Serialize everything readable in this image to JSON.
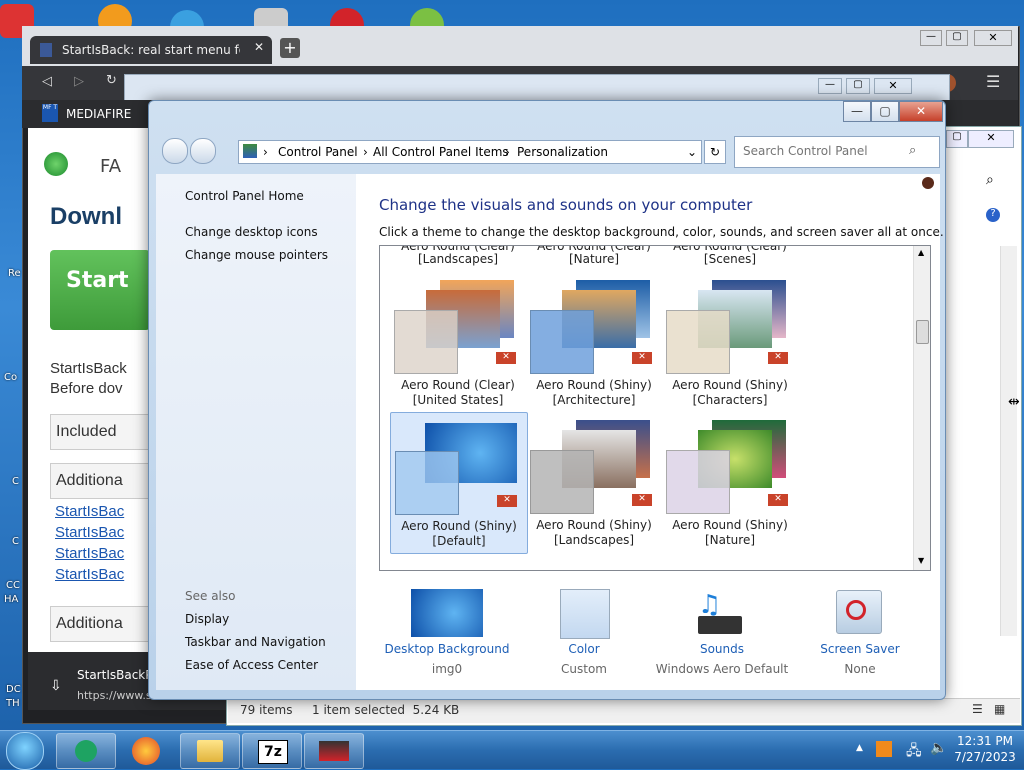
{
  "browser": {
    "tab_title": "StartIsBack: real start menu for Wi",
    "bookmark": "MEDIAFIRE",
    "bookmark_icon_text": "MF T",
    "page_letters": "FA",
    "page_title": "Downl",
    "green_button": "Start",
    "para1": "StartIsBack",
    "para2": "Before dov",
    "box1": "Included",
    "box2": "Additiona",
    "links": [
      "StartIsBac",
      "StartIsBac",
      "StartIsBac",
      "StartIsBac"
    ],
    "box3": "Additiona",
    "download_name": "StartIsBackPlu",
    "download_url": "https://www.st"
  },
  "desktop": {
    "labels": [
      "Re",
      "Co",
      "C",
      "C",
      "CC",
      "HA",
      "DC",
      "TH"
    ]
  },
  "window": {
    "address": [
      "Control Panel",
      "All Control Panel Items",
      "Personalization"
    ],
    "search_placeholder": "Search Control Panel"
  },
  "sidebar": {
    "home": "Control Panel Home",
    "links": [
      "Change desktop icons",
      "Change mouse pointers"
    ],
    "see_also": "See also",
    "see_also_links": [
      "Display",
      "Taskbar and Navigation",
      "Ease of Access Center"
    ]
  },
  "content": {
    "heading": "Change the visuals and sounds on your computer",
    "subheading": "Click a theme to change the desktop background, color, sounds, and screen saver all at once.",
    "top_row_partial": [
      "Aero Round (Clear)",
      "Aero Round (Clear)",
      "Aero Round (Clear)"
    ],
    "top_row": [
      "[Landscapes]",
      "[Nature]",
      "[Scenes]"
    ],
    "themes": [
      {
        "name": "Aero Round (Clear)",
        "sub": "[United States]"
      },
      {
        "name": "Aero Round (Shiny)",
        "sub": "[Architecture]"
      },
      {
        "name": "Aero Round (Shiny)",
        "sub": "[Characters]"
      },
      {
        "name": "Aero Round (Shiny)",
        "sub": "[Default]"
      },
      {
        "name": "Aero Round (Shiny)",
        "sub": "[Landscapes]"
      },
      {
        "name": "Aero Round (Shiny)",
        "sub": "[Nature]"
      }
    ]
  },
  "bottom": [
    {
      "title": "Desktop Background",
      "sub": "img0"
    },
    {
      "title": "Color",
      "sub": "Custom"
    },
    {
      "title": "Sounds",
      "sub": "Windows Aero Default"
    },
    {
      "title": "Screen Saver",
      "sub": "None"
    }
  ],
  "statusbar": {
    "count": "79 items",
    "selected": "1 item selected  5.24 KB"
  },
  "taskbar": {
    "time": "12:31 PM",
    "date": "7/27/2023",
    "sevenzip": "7z"
  },
  "colors": {
    "heading": "#1e3287",
    "link": "#1e5fb6",
    "accent": "#2b6db0"
  }
}
